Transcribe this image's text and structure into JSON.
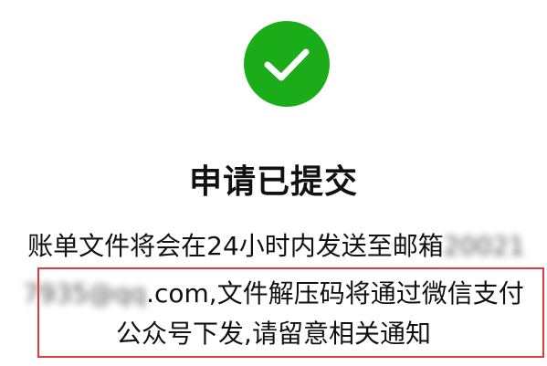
{
  "status": {
    "icon": "check-circle-icon",
    "icon_color": "#1aad19",
    "title": "申请已提交"
  },
  "message": {
    "line1_prefix": "账单文件将会在24小时内发送至邮箱",
    "line1_email_start": "20021",
    "line2_email_redacted": "7935@qq",
    "line2_email_end": ".com",
    "line2_rest": ",文件解压码将通过微信支付",
    "line3": "公众号下发,请留意相关通知"
  },
  "annotation": {
    "highlight_color": "#e03c3c"
  }
}
